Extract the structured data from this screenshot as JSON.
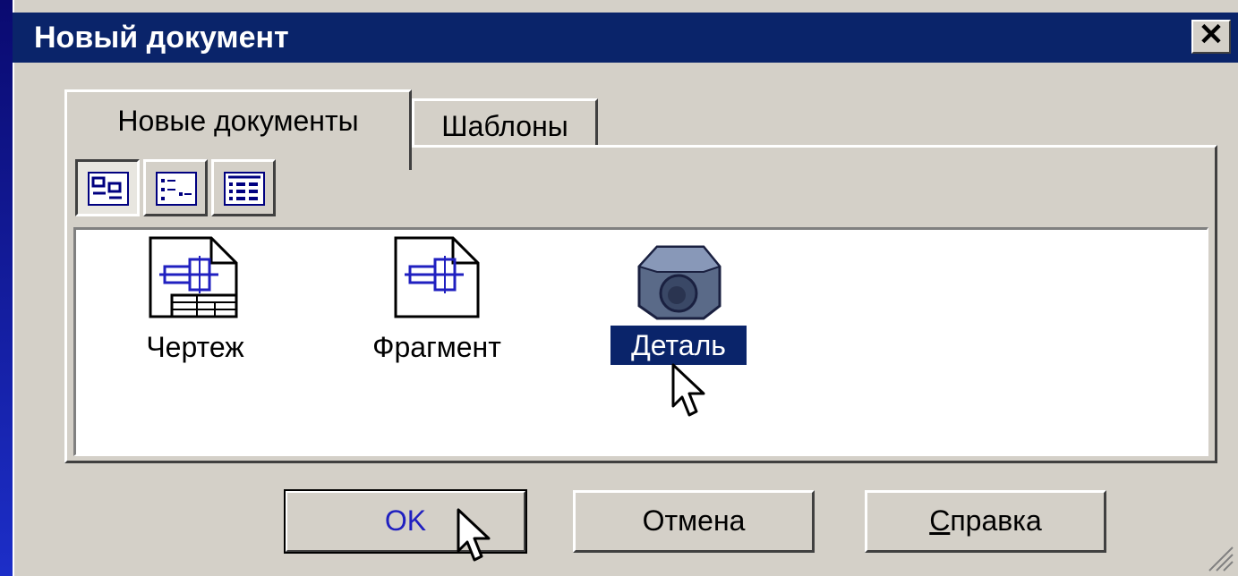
{
  "window": {
    "title": "Новый документ",
    "close_glyph": "✕"
  },
  "tabs": [
    {
      "label": "Новые документы",
      "active": true
    },
    {
      "label": "Шаблоны",
      "active": false
    }
  ],
  "view_buttons": [
    {
      "icon": "large-icons-view-icon",
      "pressed": true
    },
    {
      "icon": "list-view-icon",
      "pressed": false
    },
    {
      "icon": "details-view-icon",
      "pressed": false
    }
  ],
  "items": [
    {
      "label": "Чертеж",
      "icon": "drawing-document-icon",
      "selected": false
    },
    {
      "label": "Фрагмент",
      "icon": "fragment-document-icon",
      "selected": false
    },
    {
      "label": "Деталь",
      "icon": "part-3d-icon",
      "selected": true
    }
  ],
  "buttons": {
    "ok": "OK",
    "cancel": "Отмена",
    "help": "Справка"
  },
  "colors": {
    "titlebar": "#0a246a",
    "face": "#d4d0c8",
    "selection": "#0a246a",
    "accent": "#2020c0"
  }
}
